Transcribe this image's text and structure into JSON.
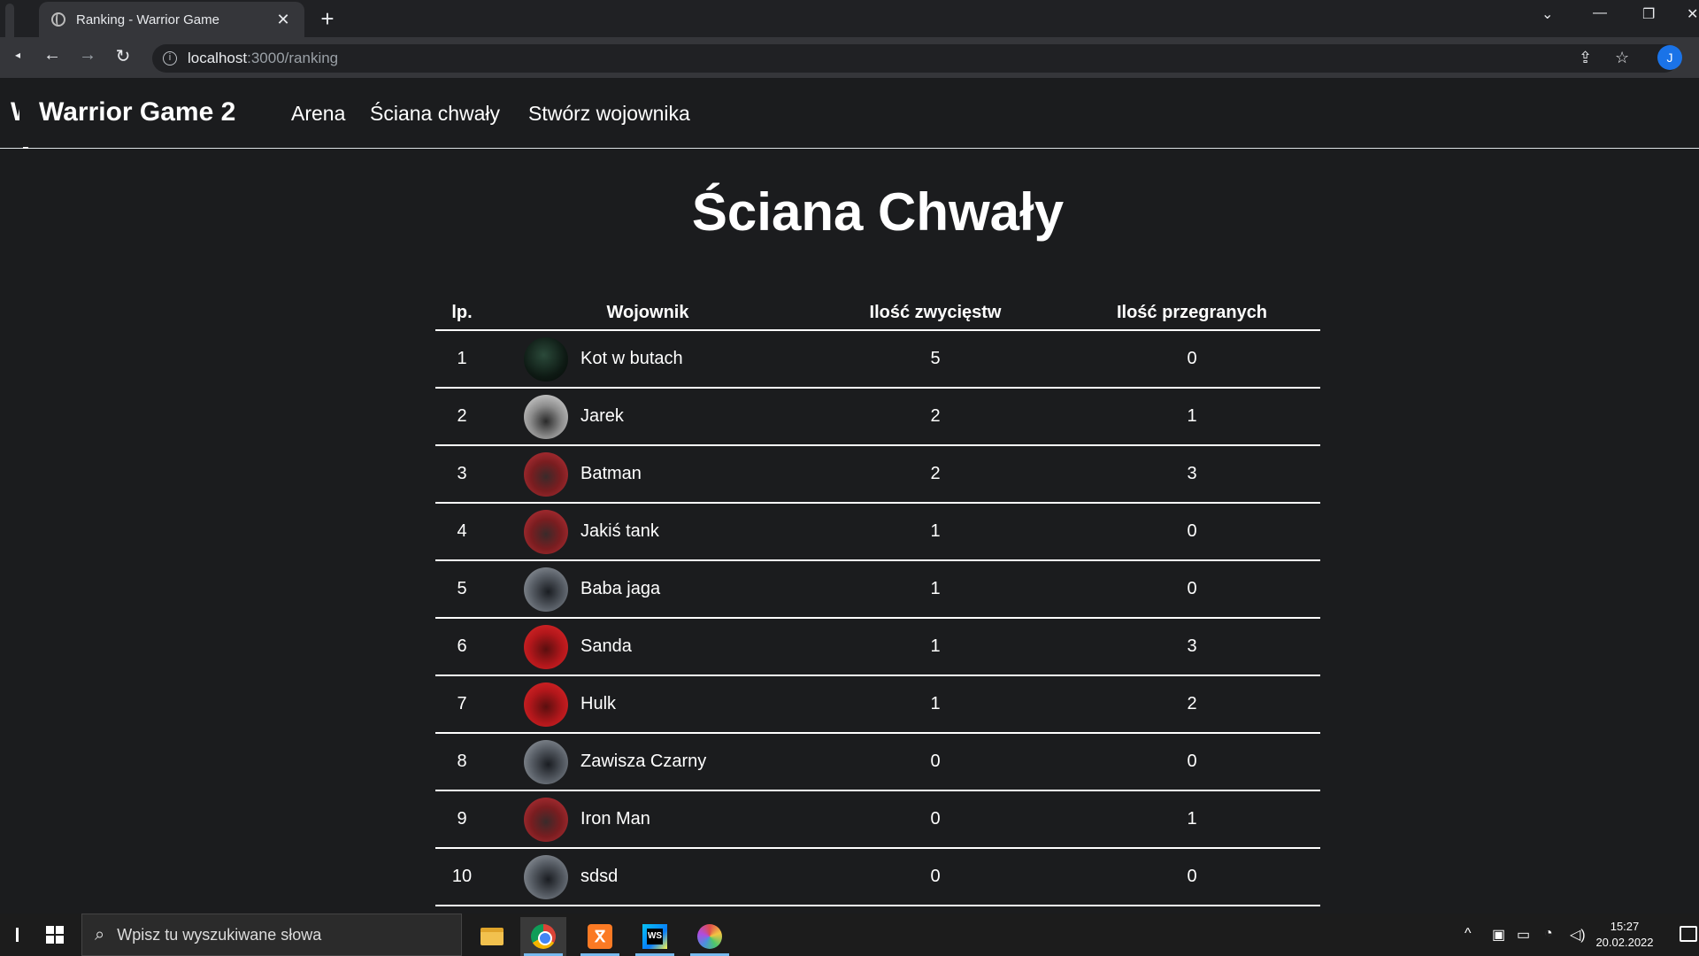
{
  "browser": {
    "tab_title": "Ranking - Warrior Game",
    "tab_close": "✕",
    "new_tab": "+",
    "url_host": "localhost",
    "url_path": ":3000/ranking"
  },
  "nav": {
    "stub": "W",
    "brand": "Warrior Game 2",
    "links": [
      "Arena",
      "Ściana chwały",
      "Stwórz wojownika"
    ]
  },
  "page": {
    "title": "Ściana Chwały"
  },
  "table": {
    "headers": [
      "lp.",
      "Wojownik",
      "Ilość zwycięstw",
      "Ilość przegranych"
    ],
    "rows": [
      {
        "lp": "1",
        "name": "Kot w butach",
        "wins": "5",
        "losses": "0",
        "avatar": "dark-green-warrior"
      },
      {
        "lp": "2",
        "name": "Jarek",
        "wins": "2",
        "losses": "1",
        "avatar": "grey-warrior"
      },
      {
        "lp": "3",
        "name": "Batman",
        "wins": "2",
        "losses": "3",
        "avatar": "red-warrior"
      },
      {
        "lp": "4",
        "name": "Jakiś tank",
        "wins": "1",
        "losses": "0",
        "avatar": "red-warrior"
      },
      {
        "lp": "5",
        "name": "Baba jaga",
        "wins": "1",
        "losses": "0",
        "avatar": "steel-warrior"
      },
      {
        "lp": "6",
        "name": "Sanda",
        "wins": "1",
        "losses": "3",
        "avatar": "bright-red-warrior"
      },
      {
        "lp": "7",
        "name": "Hulk",
        "wins": "1",
        "losses": "2",
        "avatar": "bright-red-warrior"
      },
      {
        "lp": "8",
        "name": "Zawisza Czarny",
        "wins": "0",
        "losses": "0",
        "avatar": "steel-warrior"
      },
      {
        "lp": "9",
        "name": "Iron Man",
        "wins": "0",
        "losses": "1",
        "avatar": "red-warrior"
      },
      {
        "lp": "10",
        "name": "sdsd",
        "wins": "0",
        "losses": "0",
        "avatar": "steel-warrior"
      }
    ]
  },
  "taskbar": {
    "search_placeholder": "Wpisz tu wyszukiwane słowa",
    "time": "15:27",
    "date": "20.02.2022"
  }
}
